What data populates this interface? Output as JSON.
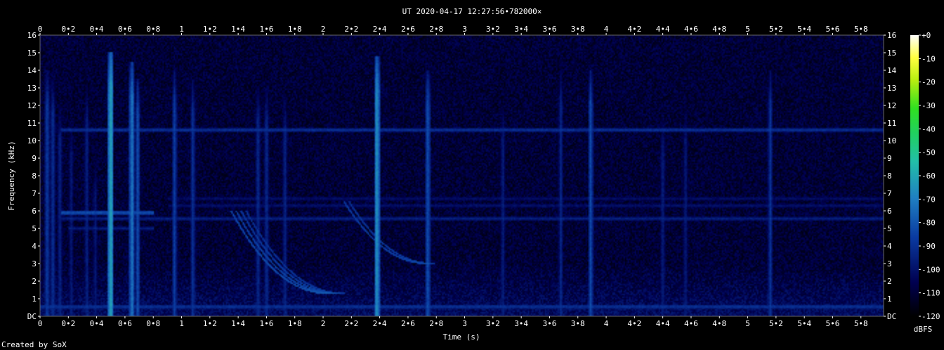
{
  "chart_data": {
    "type": "heatmap",
    "title": "UT 2020-04-17 12:27:56•782000×",
    "xlabel": "Time (s)",
    "ylabel": "Frequency (kHz)",
    "x_range": [
      0,
      5.96
    ],
    "y_range": [
      0,
      16
    ],
    "x_ticks": [
      "0",
      "0•2",
      "0•4",
      "0•6",
      "0•8",
      "1",
      "1•2",
      "1•4",
      "1•6",
      "1•8",
      "2",
      "2•2",
      "2•4",
      "2•6",
      "2•8",
      "3",
      "3•2",
      "3•4",
      "3•6",
      "3•8",
      "4",
      "4•2",
      "4•4",
      "4•6",
      "4•8",
      "5",
      "5•2",
      "5•4",
      "5•6",
      "5•8"
    ],
    "x_tick_values": [
      0,
      0.2,
      0.4,
      0.6,
      0.8,
      1,
      1.2,
      1.4,
      1.6,
      1.8,
      2,
      2.2,
      2.4,
      2.6,
      2.8,
      3,
      3.2,
      3.4,
      3.6,
      3.8,
      4,
      4.2,
      4.4,
      4.6,
      4.8,
      5,
      5.2,
      5.4,
      5.6,
      5.8
    ],
    "y_ticks": [
      "DC",
      "1",
      "2",
      "3",
      "4",
      "5",
      "6",
      "7",
      "8",
      "9",
      "10",
      "11",
      "12",
      "13",
      "14",
      "15",
      "16"
    ],
    "y_tick_values": [
      0,
      1,
      2,
      3,
      4,
      5,
      6,
      7,
      8,
      9,
      10,
      11,
      12,
      13,
      14,
      15,
      16
    ],
    "colorbar": {
      "label": "dBFS",
      "ticks": [
        "+0",
        "-10",
        "-20",
        "-30",
        "-40",
        "-50",
        "-60",
        "-70",
        "-80",
        "-90",
        "-100",
        "-110",
        "-120"
      ],
      "tick_values": [
        0,
        -10,
        -20,
        -30,
        -40,
        -50,
        -60,
        -70,
        -80,
        -90,
        -100,
        -110,
        -120
      ],
      "range": [
        -120,
        0
      ]
    },
    "features": {
      "background_level_dbfs": -110,
      "impulses": [
        {
          "t": 0.05,
          "fmax": 14.0,
          "level": -85
        },
        {
          "t": 0.09,
          "fmax": 13.5,
          "level": -88
        },
        {
          "t": 0.14,
          "fmax": 12.0,
          "level": -92
        },
        {
          "t": 0.22,
          "fmax": 11.0,
          "level": -95
        },
        {
          "t": 0.33,
          "fmax": 13.0,
          "level": -93
        },
        {
          "t": 0.39,
          "fmax": 9.0,
          "level": -96
        },
        {
          "t": 0.5,
          "fmax": 15.0,
          "level": -60
        },
        {
          "t": 0.65,
          "fmax": 14.5,
          "level": -72
        },
        {
          "t": 0.69,
          "fmax": 13.5,
          "level": -82
        },
        {
          "t": 0.95,
          "fmax": 14.0,
          "level": -85
        },
        {
          "t": 1.08,
          "fmax": 13.5,
          "level": -88
        },
        {
          "t": 1.54,
          "fmax": 13.0,
          "level": -90
        },
        {
          "t": 1.6,
          "fmax": 13.0,
          "level": -90
        },
        {
          "t": 1.73,
          "fmax": 12.5,
          "level": -92
        },
        {
          "t": 2.38,
          "fmax": 14.8,
          "level": -65
        },
        {
          "t": 2.74,
          "fmax": 14.0,
          "level": -80
        },
        {
          "t": 3.27,
          "fmax": 12.0,
          "level": -94
        },
        {
          "t": 3.68,
          "fmax": 14.0,
          "level": -92
        },
        {
          "t": 3.89,
          "fmax": 14.0,
          "level": -82
        },
        {
          "t": 4.4,
          "fmax": 11.5,
          "level": -94
        },
        {
          "t": 4.56,
          "fmax": 12.0,
          "level": -95
        },
        {
          "t": 5.16,
          "fmax": 14.0,
          "level": -88
        }
      ],
      "tones": [
        {
          "f": 10.6,
          "t0": 0.15,
          "t1": 5.96,
          "level": -90
        },
        {
          "f": 5.9,
          "t0": 0.15,
          "t1": 0.8,
          "level": -80
        },
        {
          "f": 5.55,
          "t0": 0.15,
          "t1": 5.96,
          "level": -94
        },
        {
          "f": 6.3,
          "t0": 0.9,
          "t1": 5.96,
          "level": -99
        },
        {
          "f": 6.7,
          "t0": 0.9,
          "t1": 5.96,
          "level": -100
        },
        {
          "f": 5.0,
          "t0": 0.2,
          "t1": 0.8,
          "level": -96
        },
        {
          "f": 0.55,
          "t0": 0.0,
          "t1": 5.96,
          "level": -88
        }
      ],
      "whistlers": [
        {
          "t0": 1.35,
          "f_start": 6.0,
          "t_end": 2.05,
          "f_end": 1.3,
          "strands": 4,
          "level": -88
        },
        {
          "t0": 2.15,
          "f_start": 6.5,
          "t_end": 2.75,
          "f_end": 3.0,
          "strands": 2,
          "level": -92
        }
      ]
    }
  },
  "footer": {
    "credit": "Created by SoX"
  }
}
